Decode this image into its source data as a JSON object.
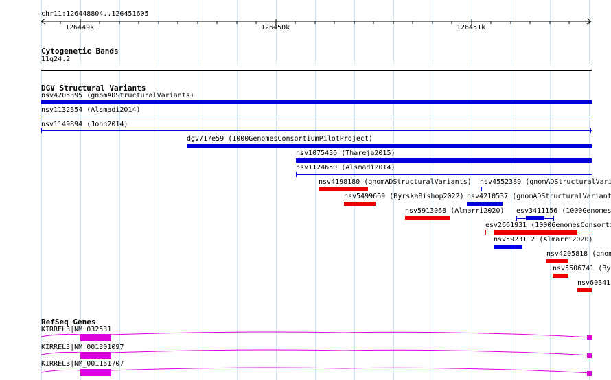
{
  "ruler": {
    "range_label": "chr11:126448804..126451605",
    "ticks": [
      "126449k",
      "126450k",
      "126451k"
    ]
  },
  "tracks": {
    "cytoband": {
      "title": "Cytogenetic Bands",
      "band": "11q24.2"
    },
    "dgv": {
      "title": "DGV Structural Variants",
      "features": [
        {
          "label": "nsv4205395 (gnomADStructuralVariants)",
          "color": "#0000dd"
        },
        {
          "label": "nsv1132354 (Alsmadi2014)",
          "color": "#0000dd"
        },
        {
          "label": "nsv1149894 (John2014)",
          "color": "#0000dd"
        },
        {
          "label": "dgv717e59 (1000GenomesConsortiumPilotProject)",
          "color": "#0000dd"
        },
        {
          "label": "nsv1075436 (Thareja2015)",
          "color": "#0000dd"
        },
        {
          "label": "nsv1124650 (Alsmadi2014)",
          "color": "#0000dd"
        },
        {
          "label": "nsv4198180 (gnomADStructuralVariants)",
          "color": "#ee0000"
        },
        {
          "label": "nsv4552389 (gnomADStructuralVari",
          "color": "#0000dd"
        },
        {
          "label": "nsv5499669 (ByrskaBishop2022)",
          "color": "#ee0000"
        },
        {
          "label": "nsv4210537 (gnomADStructuralVariant",
          "color": "#0000dd"
        },
        {
          "label": "nsv5913068 (Almarri2020)",
          "color": "#ee0000"
        },
        {
          "label": "esv3411156 (1000Genomes",
          "color": "#0000dd"
        },
        {
          "label": "esv2661931 (1000GenomesConsorti",
          "color": "#ee0000"
        },
        {
          "label": "nsv5923112 (Almarri2020)",
          "color": "#0000dd"
        },
        {
          "label": "nsv4205818 (gnom",
          "color": "#ee0000"
        },
        {
          "label": "nsv5506741 (Byr",
          "color": "#ee0000"
        },
        {
          "label": "nsv60341",
          "color": "#ee0000"
        }
      ]
    },
    "refseq": {
      "title": "RefSeq Genes",
      "genes": [
        {
          "label": "KIRREL3|NM_032531"
        },
        {
          "label": "KIRREL3|NM_001301097"
        },
        {
          "label": "KIRREL3|NM_001161707"
        }
      ],
      "color": "#dd00dd"
    }
  }
}
